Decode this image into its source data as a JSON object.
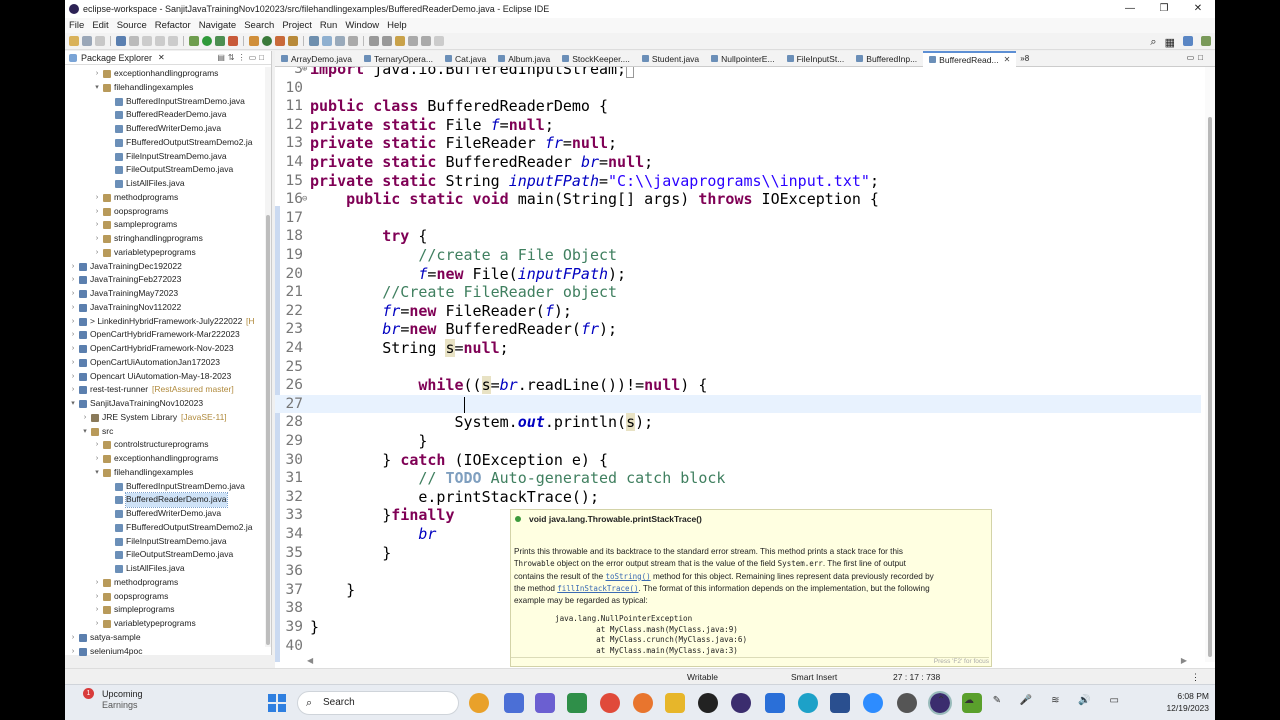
{
  "window": {
    "title": "eclipse-workspace - SanjitJavaTrainingNov102023/src/filehandlingexamples/BufferedReaderDemo.java - Eclipse IDE",
    "controls": [
      "—",
      "❐",
      "✕"
    ]
  },
  "menubar": [
    "File",
    "Edit",
    "Source",
    "Refactor",
    "Navigate",
    "Search",
    "Project",
    "Run",
    "Window",
    "Help"
  ],
  "package_explorer": {
    "title": "Package Explorer",
    "close": "✕",
    "items": [
      {
        "label": "exceptionhandlingprograms",
        "depth": 2,
        "kind": "package",
        "expanded": false
      },
      {
        "label": "filehandlingexamples",
        "depth": 2,
        "kind": "package",
        "expanded": true
      },
      {
        "label": "BufferedInputStreamDemo.java",
        "depth": 3,
        "kind": "java"
      },
      {
        "label": "BufferedReaderDemo.java",
        "depth": 3,
        "kind": "java"
      },
      {
        "label": "BufferedWriterDemo.java",
        "depth": 3,
        "kind": "java"
      },
      {
        "label": "FBufferedOutputStreamDemo2.ja",
        "depth": 3,
        "kind": "java"
      },
      {
        "label": "FileInputStreamDemo.java",
        "depth": 3,
        "kind": "java"
      },
      {
        "label": "FileOutputStreamDemo.java",
        "depth": 3,
        "kind": "java"
      },
      {
        "label": "ListAllFiles.java",
        "depth": 3,
        "kind": "java"
      },
      {
        "label": "methodprograms",
        "depth": 2,
        "kind": "package",
        "expanded": false
      },
      {
        "label": "oopsprograms",
        "depth": 2,
        "kind": "package",
        "expanded": false
      },
      {
        "label": "sampleprograms",
        "depth": 2,
        "kind": "package",
        "expanded": false
      },
      {
        "label": "stringhandlingprograms",
        "depth": 2,
        "kind": "package",
        "expanded": false
      },
      {
        "label": "variabletypeprograms",
        "depth": 2,
        "kind": "package",
        "expanded": false
      },
      {
        "label": "JavaTrainingDec192022",
        "depth": 0,
        "kind": "project",
        "expanded": false
      },
      {
        "label": "JavaTrainingFeb272023",
        "depth": 0,
        "kind": "project",
        "expanded": false
      },
      {
        "label": "JavaTrainingMay72023",
        "depth": 0,
        "kind": "project",
        "expanded": false
      },
      {
        "label": "JavaTrainingNov112022",
        "depth": 0,
        "kind": "project",
        "expanded": false
      },
      {
        "label": "> LinkedinHybridFramework-July222022",
        "deco": "[H",
        "depth": 0,
        "kind": "project",
        "expanded": false
      },
      {
        "label": "OpenCartHybridFramework-Mar222023",
        "depth": 0,
        "kind": "project",
        "expanded": false
      },
      {
        "label": "OpenCartHybridFramework-Nov-2023",
        "depth": 0,
        "kind": "project",
        "expanded": false
      },
      {
        "label": "OpenCartUiAutomationJan172023",
        "depth": 0,
        "kind": "project",
        "expanded": false
      },
      {
        "label": "Opencart UiAutomation-May-18-2023",
        "depth": 0,
        "kind": "project",
        "expanded": false
      },
      {
        "label": "rest-test-runner",
        "deco": "[RestAssured master]",
        "depth": 0,
        "kind": "project",
        "expanded": false
      },
      {
        "label": "SanjitJavaTrainingNov102023",
        "depth": 0,
        "kind": "project",
        "expanded": true
      },
      {
        "label": "JRE System Library",
        "deco": "[JavaSE-11]",
        "depth": 1,
        "kind": "library",
        "expanded": false
      },
      {
        "label": "src",
        "depth": 1,
        "kind": "folder",
        "expanded": true
      },
      {
        "label": "controlstructureprograms",
        "depth": 2,
        "kind": "package",
        "expanded": false
      },
      {
        "label": "exceptionhandlingprograms",
        "depth": 2,
        "kind": "package",
        "expanded": false
      },
      {
        "label": "filehandlingexamples",
        "depth": 2,
        "kind": "package",
        "expanded": true
      },
      {
        "label": "BufferedInputStreamDemo.java",
        "depth": 3,
        "kind": "java"
      },
      {
        "label": "BufferedReaderDemo.java",
        "depth": 3,
        "kind": "java",
        "selected": true
      },
      {
        "label": "BufferedWriterDemo.java",
        "depth": 3,
        "kind": "java"
      },
      {
        "label": "FBufferedOutputStreamDemo2.ja",
        "depth": 3,
        "kind": "java"
      },
      {
        "label": "FileInputStreamDemo.java",
        "depth": 3,
        "kind": "java"
      },
      {
        "label": "FileOutputStreamDemo.java",
        "depth": 3,
        "kind": "java"
      },
      {
        "label": "ListAllFiles.java",
        "depth": 3,
        "kind": "java"
      },
      {
        "label": "methodprograms",
        "depth": 2,
        "kind": "package",
        "expanded": false
      },
      {
        "label": "oopsprograms",
        "depth": 2,
        "kind": "package",
        "expanded": false
      },
      {
        "label": "simpleprograms",
        "depth": 2,
        "kind": "package",
        "expanded": false
      },
      {
        "label": "variabletypeprograms",
        "depth": 2,
        "kind": "package",
        "expanded": false
      },
      {
        "label": "satya-sample",
        "depth": 0,
        "kind": "project",
        "expanded": false
      },
      {
        "label": "selenium4poc",
        "depth": 0,
        "kind": "project",
        "expanded": false
      }
    ]
  },
  "editor": {
    "tabs": [
      {
        "label": "ArrayDemo.java",
        "active": false
      },
      {
        "label": "TernaryOpera...",
        "active": false
      },
      {
        "label": "Cat.java",
        "active": false
      },
      {
        "label": "Album.java",
        "active": false
      },
      {
        "label": "StockKeeper....",
        "active": false
      },
      {
        "label": "Student.java",
        "active": false
      },
      {
        "label": "NullpointerE...",
        "active": false
      },
      {
        "label": "FileInputSt...",
        "active": false
      },
      {
        "label": "BufferedInp...",
        "active": false
      },
      {
        "label": "BufferedRead...",
        "active": true
      }
    ],
    "tab_overflow": "»8",
    "lines": [
      {
        "n": "3",
        "html": "<span class='kw'>import</span> java.io.BufferedInputStream;<span style='border:1px solid #999;font-size:10px'>&nbsp;</span>",
        "fold": "⊕",
        "partial": true
      },
      {
        "n": "10",
        "html": ""
      },
      {
        "n": "11",
        "html": "<span class='kw'>public class</span> BufferedReaderDemo {"
      },
      {
        "n": "12",
        "html": "<span class='kw'>private static</span> File <span class='fld'>f</span>=<span class='kw'>null</span>;"
      },
      {
        "n": "13",
        "html": "<span class='kw'>private static</span> FileReader <span class='fld'>fr</span>=<span class='kw'>null</span>;"
      },
      {
        "n": "14",
        "html": "<span class='kw'>private static</span> BufferedReader <span class='fld'>br</span>=<span class='kw'>null</span>;"
      },
      {
        "n": "15",
        "html": "<span class='kw'>private static</span> String <span class='fld'>inputFPath</span>=<span class='str'>\"C:\\\\javaprograms\\\\input.txt\"</span>;"
      },
      {
        "n": "16",
        "html": "    <span class='kw'>public static void</span> main(String[] args) <span class='kw'>throws</span> IOException {",
        "fold": "⊖"
      },
      {
        "n": "17",
        "html": ""
      },
      {
        "n": "18",
        "html": "        <span class='kw'>try</span> {"
      },
      {
        "n": "19",
        "html": "            <span class='cmt'>//create a File Object</span>"
      },
      {
        "n": "20",
        "html": "            <span class='fld'>f</span>=<span class='kw'>new</span> File(<span class='fld'>inputFPath</span>);"
      },
      {
        "n": "21",
        "html": "        <span class='cmt'>//Create FileReader object</span>"
      },
      {
        "n": "22",
        "html": "        <span class='fld'>fr</span>=<span class='kw'>new</span> FileReader(<span class='fld'>f</span>);"
      },
      {
        "n": "23",
        "html": "        <span class='fld'>br</span>=<span class='kw'>new</span> BufferedReader(<span class='fld'>fr</span>);"
      },
      {
        "n": "24",
        "html": "        String <span class='hl'>s</span>=<span class='kw'>null</span>;"
      },
      {
        "n": "25",
        "html": ""
      },
      {
        "n": "26",
        "html": "            <span class='kw'>while</span>((<span class='hl'>s</span>=<span class='fld'>br</span>.readLine())!=<span class='kw'>null</span>) {"
      },
      {
        "n": "27",
        "html": "",
        "current": true
      },
      {
        "n": "28",
        "html": "                System.<span class='out'>out</span>.println(<span class='hl'>s</span>);"
      },
      {
        "n": "29",
        "html": "            }"
      },
      {
        "n": "30",
        "html": "        } <span class='kw'>catch</span> (IOException e) {"
      },
      {
        "n": "31",
        "html": "            <span class='cmt'>// <span class='todo'>TODO</span> Auto-generated catch block</span>"
      },
      {
        "n": "32",
        "html": "            e.printStackTrace();"
      },
      {
        "n": "33",
        "html": "        }<span class='kw'>finally</span>"
      },
      {
        "n": "34",
        "html": "            <span class='fld'>br</span>"
      },
      {
        "n": "35",
        "html": "        }"
      },
      {
        "n": "36",
        "html": ""
      },
      {
        "n": "37",
        "html": "    }"
      },
      {
        "n": "38",
        "html": ""
      },
      {
        "n": "39",
        "html": "}"
      },
      {
        "n": "40",
        "html": ""
      }
    ]
  },
  "tooltip": {
    "title": "void java.lang.Throwable.printStackTrace()",
    "p1": "Prints this throwable and its backtrace to the standard error stream. This method prints a stack trace for this",
    "code_throwable": "Throwable",
    "p2a": "object on the error output stream that is the value of the field",
    "code_syserr": "System.err",
    "p2b": ". The first line of output",
    "p3a": "contains the result of the",
    "link_tostring": "toString()",
    "p3b": "method for this object. Remaining lines represent data previously recorded by",
    "p4a": "the method",
    "link_fill": "fillInStackTrace()",
    "p4b": ". The format of this information depends on the implementation, but the following",
    "p5": "example may be regarded as typical:",
    "example": "java.lang.NullPointerException\n         at MyClass.mash(MyClass.java:9)\n         at MyClass.crunch(MyClass.java:6)\n         at MyClass.main(MyClass.java:3)",
    "footer": "Press 'F2' for focus"
  },
  "statusbar": {
    "mode": "Writable",
    "insert": "Smart Insert",
    "position": "27 : 17 : 738"
  },
  "taskbar": {
    "weather_badge": "1",
    "weather_title": "Upcoming",
    "weather_sub": "Earnings",
    "search_placeholder": "Search",
    "time": "6:08 PM",
    "date": "12/19/2023"
  },
  "colors": {
    "keyword": "#7f0055",
    "field": "#0000c0",
    "string": "#2a00ff",
    "comment": "#3f7f5f",
    "tooltip_bg": "#ffffe1"
  }
}
